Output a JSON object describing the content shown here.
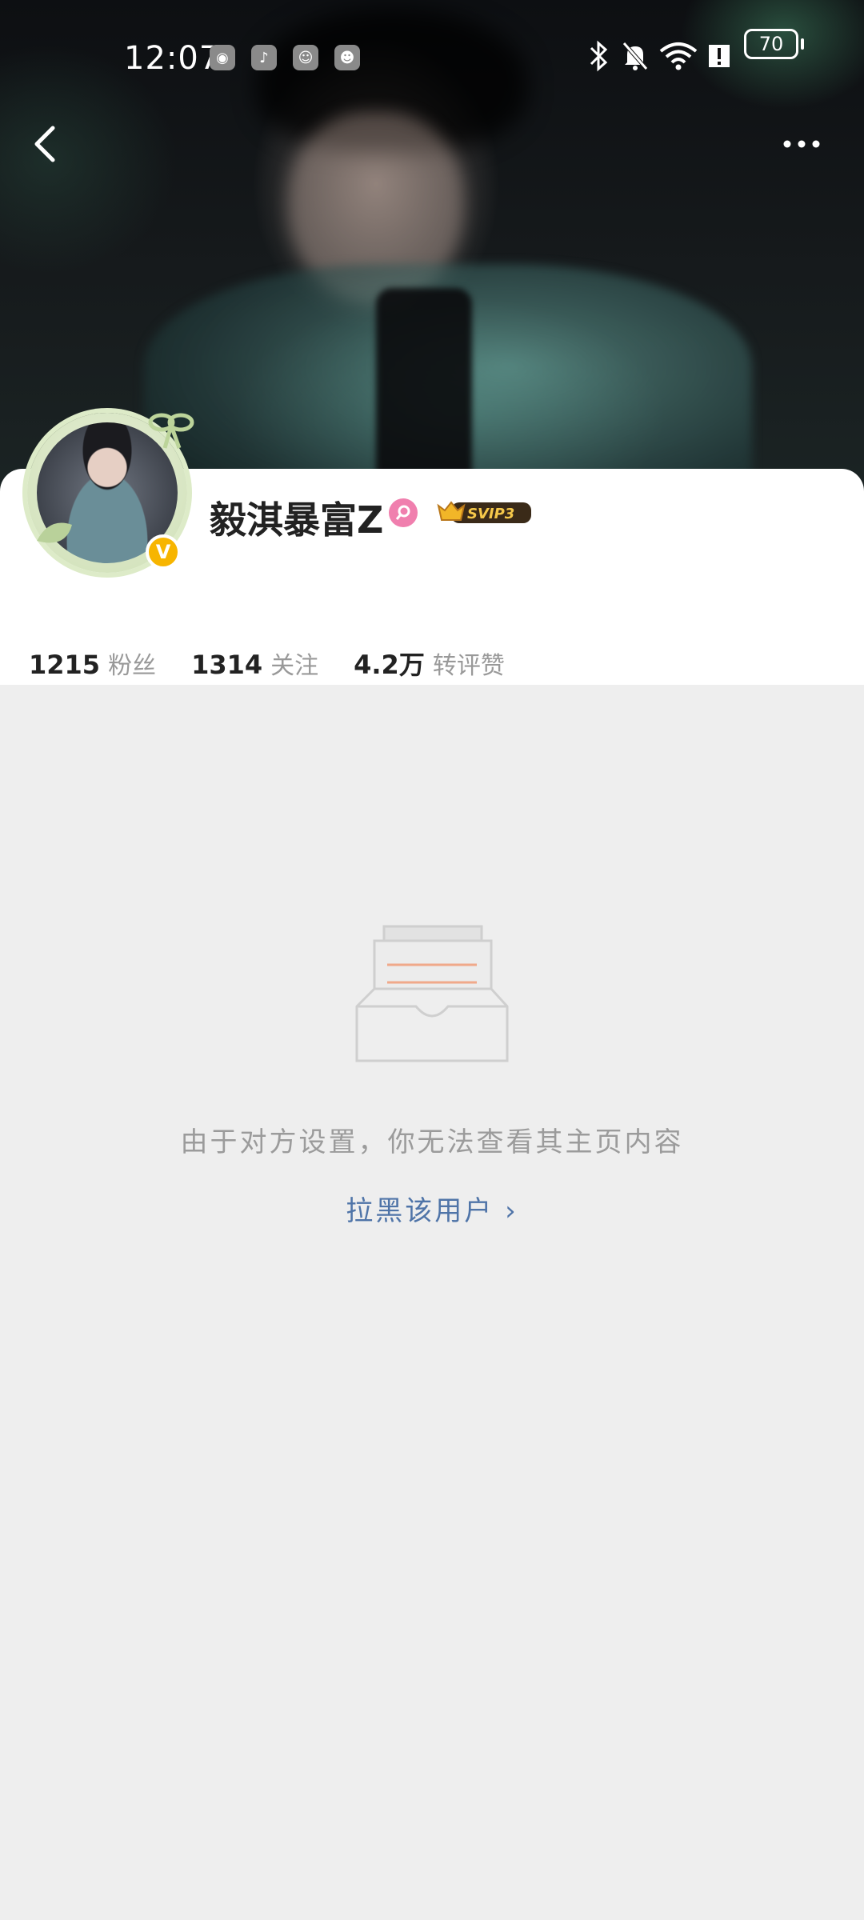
{
  "status_bar": {
    "time": "12:07",
    "battery": "70"
  },
  "profile": {
    "username": "毅淇暴富Z",
    "svip_badge": "SVIP3",
    "stats": [
      {
        "value": "1215",
        "label": "粉丝"
      },
      {
        "value": "1314",
        "label": "关注"
      },
      {
        "value": "4.2万",
        "label": "转评赞"
      }
    ]
  },
  "empty_state": {
    "message": "由于对方设置，你无法查看其主页内容",
    "block_link": "拉黑该用户 ›"
  },
  "icons": {
    "back": "back-arrow-icon",
    "more": "more-dots-icon",
    "verified": "verified-v-icon",
    "gender": "female-gender-icon"
  },
  "colors": {
    "link": "#4f74a8",
    "verified": "#f7b500",
    "gender": "#f07fae",
    "background": "#eeeeee"
  }
}
